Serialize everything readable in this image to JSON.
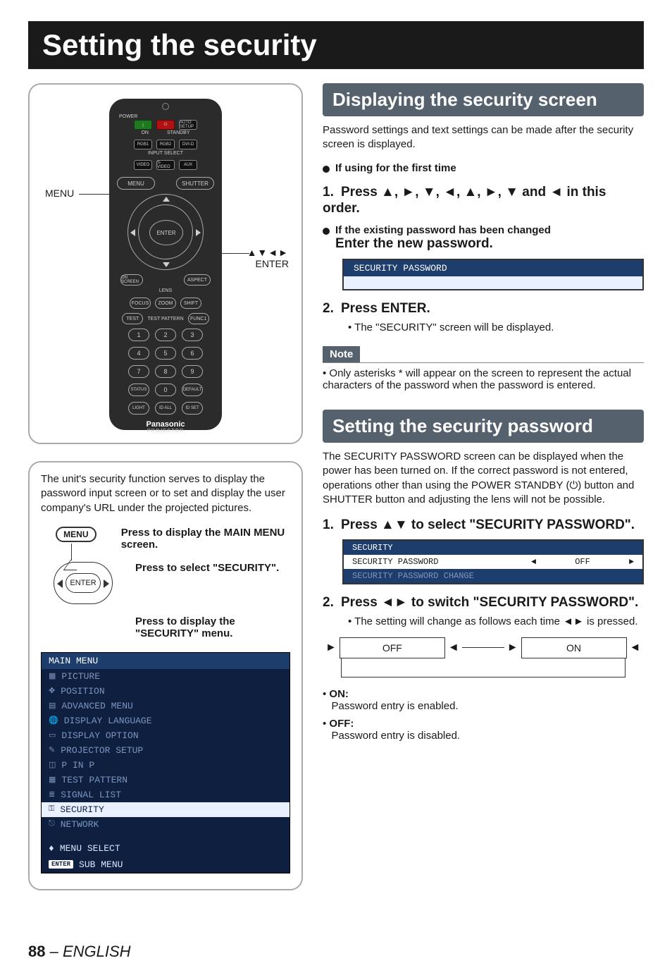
{
  "page_title": "Setting the security",
  "remote": {
    "labels": {
      "power": "POWER",
      "auto_setup": "AUTO SETUP",
      "on": "ON",
      "standby": "STANDBY",
      "rgb1": "RGB1",
      "rgb2": "RGB2",
      "dvi_d": "DVI-D",
      "input_select": "INPUT SELECT",
      "video": "VIDEO",
      "s_video": "S-VIDEO",
      "aux": "AUX",
      "menu": "MENU",
      "shutter": "SHUTTER",
      "enter": "ENTER",
      "on_screen": "ON SCREEN",
      "aspect": "ASPECT",
      "lens": "LENS",
      "focus": "FOCUS",
      "zoom": "ZOOM",
      "shift": "SHIFT",
      "test": "TEST",
      "test_pattern": "TEST PATTERN",
      "func1": "FUNC1",
      "status": "STATUS",
      "default": "DEFAULT",
      "light": "LIGHT",
      "id_all": "ID ALL",
      "id_set": "ID SET",
      "brand": "Panasonic",
      "brand_sub": "PROJECTOR"
    },
    "numbers": [
      "1",
      "2",
      "3",
      "4",
      "5",
      "6",
      "7",
      "8",
      "9",
      "0"
    ],
    "callouts": {
      "menu": "MENU",
      "enter_header": "▲▼◄►",
      "enter_label": "ENTER"
    }
  },
  "info_box": {
    "intro": "The unit's security function serves to display the password input screen or to set and display the user company's URL under the projected pictures.",
    "hint_menu_btn": "MENU",
    "hint_enter_btn": "ENTER",
    "step1": "Press to display the MAIN MENU screen.",
    "step2": "Press to select \"SECURITY\".",
    "step3": "Press to display the \"SECURITY\" menu.",
    "main_menu": {
      "title": "MAIN MENU",
      "items": [
        "PICTURE",
        "POSITION",
        "ADVANCED MENU",
        "DISPLAY LANGUAGE",
        "DISPLAY OPTION",
        "PROJECTOR SETUP",
        "P IN P",
        "TEST PATTERN",
        "SIGNAL LIST",
        "SECURITY",
        "NETWORK"
      ],
      "selected_index": 9,
      "footer1_icon": "♦",
      "footer1": "MENU SELECT",
      "footer2_key": "ENTER",
      "footer2": "SUB MENU"
    }
  },
  "right": {
    "sec1_title": "Displaying the security screen",
    "sec1_para": "Password settings and text settings can be made after the security screen is displayed.",
    "sec1_bullet1": "If using for the first time",
    "sec1_step1": "Press ▲, ►, ▼, ◄, ▲, ►, ▼ and ◄ in this order.",
    "sec1_bullet2_a": "If the existing password has been changed",
    "sec1_bullet2_b": "Enter the new password.",
    "secpw_box_label": "SECURITY PASSWORD",
    "sec1_step2": "Press ENTER.",
    "sec1_step2_sub": "The \"SECURITY\" screen will be displayed.",
    "note_label": "Note",
    "note_text": "Only asterisks * will appear on the screen to represent the actual characters of the password when the password is entered.",
    "sec2_title": "Setting the security password",
    "sec2_para": "The SECURITY PASSWORD screen can be displayed when the power has been turned on. If the correct password is not entered, operations other than using the POWER STANDBY (⏻) button and SHUTTER button and adjusting the lens will not be possible.",
    "sec2_step1": "Press ▲▼ to select \"SECURITY PASSWORD\".",
    "sec2_menu": {
      "title": "SECURITY",
      "row_sel": "SECURITY PASSWORD",
      "row_sel_val": "OFF",
      "row_dim": "SECURITY PASSWORD CHANGE"
    },
    "sec2_step2": "Press ◄► to switch \"SECURITY PASSWORD\".",
    "sec2_step2_sub": "The setting will change as follows each time ◄► is pressed.",
    "toggle_off": "OFF",
    "toggle_on": "ON",
    "on_label": "ON:",
    "on_text": "Password entry is enabled.",
    "off_label": "OFF:",
    "off_text": "Password entry is disabled."
  },
  "footer": {
    "page": "88",
    "sep": " – ",
    "lang": "ENGLISH"
  }
}
